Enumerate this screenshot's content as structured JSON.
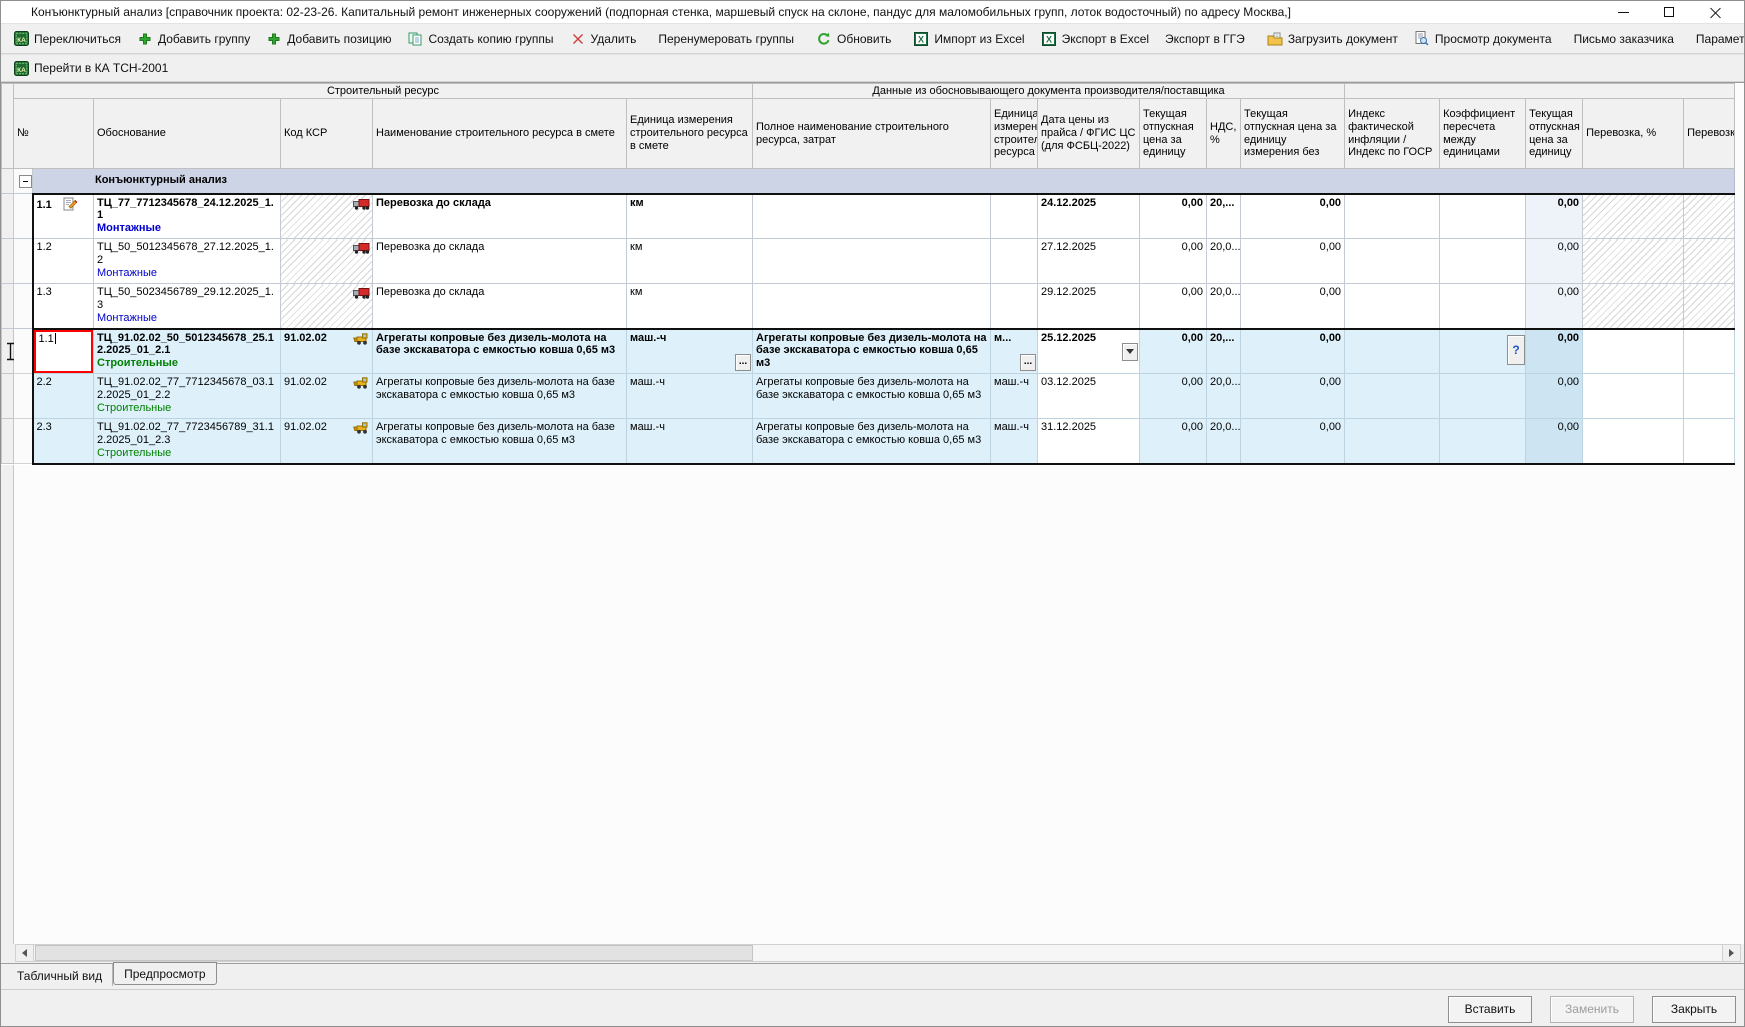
{
  "window": {
    "title": "Конъюнктурный анализ [справочник проекта: 02-23-26. Капитальный ремонт инженерных сооружений (подпорная стенка, маршевый спуск на склоне, пандус для маломобильных групп, лоток водосточный) по адресу Москва,]"
  },
  "toolbar": {
    "items": [
      {
        "label": "Переключиться",
        "icon": "ka-icon"
      },
      {
        "label": "Добавить группу",
        "icon": "plus-icon"
      },
      {
        "label": "Добавить позицию",
        "icon": "plus-icon"
      },
      {
        "label": "Создать копию группы",
        "icon": "copy-icon"
      },
      {
        "label": "Удалить",
        "icon": "delete-icon"
      },
      {
        "sep": true
      },
      {
        "label": "Перенумеровать группы"
      },
      {
        "sep": true
      },
      {
        "label": "Обновить",
        "icon": "refresh-icon"
      },
      {
        "sep": true
      },
      {
        "label": "Импорт из Excel",
        "icon": "excel-icon"
      },
      {
        "label": "Экспорт в Excel",
        "icon": "excel-icon"
      },
      {
        "label": "Экспорт в ГГЭ"
      },
      {
        "sep": true
      },
      {
        "label": "Загрузить документ",
        "icon": "upload-doc-icon"
      },
      {
        "label": "Просмотр документа",
        "icon": "view-doc-icon"
      },
      {
        "sep": true
      },
      {
        "label": "Письмо заказчика"
      },
      {
        "sep": true
      },
      {
        "label": "Параметры"
      }
    ]
  },
  "toolbar2": {
    "items": [
      {
        "label": "Перейти в КА ТСН-2001",
        "icon": "ka-icon"
      }
    ]
  },
  "table": {
    "band_left": "Строительный ресурс",
    "band_center": "Данные из обосновывающего документа производителя/поставщика",
    "group_label": "Конъюнктурный анализ",
    "columns": [
      "№",
      "Обоснование",
      "Код КСР",
      "Наименование строительного ресурса в смете",
      "Единица измерения строительного ресурса в смете",
      "Полное наименование строительного ресурса, затрат",
      "Единица измерения строительного ресурса",
      "Дата цены из прайса / ФГИС ЦС (для ФСБЦ-2022)",
      "Текущая отпускная цена за единицу",
      "НДС, %",
      "Текущая отпускная цена за единицу измерения без",
      "Индекс фактической инфляции / Индекс по  ГОСР",
      "Коэффициент пересчета между единицами",
      "Текущая отпускная цена за единицу",
      "Перевозка, %",
      "Перевозка"
    ],
    "rows": [
      {
        "num": "1.1",
        "editing": false,
        "note_icon": true,
        "basis": "ТЦ_77_7712345678_24.12.2025_1.1",
        "category": "Монтажные",
        "category_class": "cat-blue",
        "ksr_code": "",
        "ksr_hatched": true,
        "vehicle": "red-truck",
        "name": "Перевозка до склада",
        "unit": "км",
        "full_name": "",
        "full_unit": "",
        "price_date": "24.12.2025",
        "price": "0,00",
        "vat": "20,...",
        "price_no_vat": "0,00",
        "inflation": "",
        "coef": "",
        "unit_price": "0,00",
        "bold": true,
        "highlight": false,
        "group_start": true,
        "group_end": false,
        "date_dropdown": false,
        "unit_ellipsis": false,
        "full_unit_ellipsis": false,
        "coef_help": false
      },
      {
        "num": "1.2",
        "editing": false,
        "note_icon": false,
        "basis": "ТЦ_50_5012345678_27.12.2025_1.2",
        "category": "Монтажные",
        "category_class": "cat-blue",
        "ksr_code": "",
        "ksr_hatched": true,
        "vehicle": "red-truck",
        "name": "Перевозка до склада",
        "unit": "км",
        "full_name": "",
        "full_unit": "",
        "price_date": "27.12.2025",
        "price": "0,00",
        "vat": "20,0...",
        "price_no_vat": "0,00",
        "inflation": "",
        "coef": "",
        "unit_price": "0,00",
        "bold": false,
        "highlight": false,
        "group_start": false,
        "group_end": false,
        "date_dropdown": false,
        "unit_ellipsis": false,
        "full_unit_ellipsis": false,
        "coef_help": false
      },
      {
        "num": "1.3",
        "editing": false,
        "note_icon": false,
        "basis": "ТЦ_50_5023456789_29.12.2025_1.3",
        "category": "Монтажные",
        "category_class": "cat-blue",
        "ksr_code": "",
        "ksr_hatched": true,
        "vehicle": "red-truck",
        "name": "Перевозка до склада",
        "unit": "км",
        "full_name": "",
        "full_unit": "",
        "price_date": "29.12.2025",
        "price": "0,00",
        "vat": "20,0...",
        "price_no_vat": "0,00",
        "inflation": "",
        "coef": "",
        "unit_price": "0,00",
        "bold": false,
        "highlight": false,
        "group_start": false,
        "group_end": true,
        "date_dropdown": false,
        "unit_ellipsis": false,
        "full_unit_ellipsis": false,
        "coef_help": false
      },
      {
        "num": "1.1",
        "editing": true,
        "note_icon": false,
        "basis": "ТЦ_91.02.02_50_5012345678_25.12.2025_01_2.1",
        "category": "Строительные",
        "category_class": "cat-green",
        "ksr_code": "91.02.02",
        "ksr_hatched": false,
        "vehicle": "yellow-loader",
        "name": "Агрегаты копровые без дизель-молота на базе экскаватора с емкостью ковша 0,65 м3",
        "unit": "маш.-ч",
        "full_name": "Агрегаты копровые без дизель-молота на базе экскаватора с емкостью ковша 0,65 м3",
        "full_unit": "м...",
        "price_date": "25.12.2025",
        "price": "0,00",
        "vat": "20,...",
        "price_no_vat": "0,00",
        "inflation": "",
        "coef": "",
        "unit_price": "0,00",
        "bold": true,
        "highlight": true,
        "group_start": true,
        "group_end": false,
        "date_dropdown": true,
        "unit_ellipsis": true,
        "full_unit_ellipsis": true,
        "coef_help": true
      },
      {
        "num": "2.2",
        "editing": false,
        "note_icon": false,
        "basis": "ТЦ_91.02.02_77_7712345678_03.12.2025_01_2.2",
        "category": "Строительные",
        "category_class": "cat-green",
        "ksr_code": "91.02.02",
        "ksr_hatched": false,
        "vehicle": "yellow-loader",
        "name": "Агрегаты копровые без дизель-молота на базе экскаватора с емкостью ковша 0,65 м3",
        "unit": "маш.-ч",
        "full_name": "Агрегаты копровые без дизель-молота на базе экскаватора с емкостью ковша 0,65 м3",
        "full_unit": "маш.-ч",
        "price_date": "03.12.2025",
        "price": "0,00",
        "vat": "20,0...",
        "price_no_vat": "0,00",
        "inflation": "",
        "coef": "",
        "unit_price": "0,00",
        "bold": false,
        "highlight": true,
        "group_start": false,
        "group_end": false,
        "date_dropdown": false,
        "unit_ellipsis": false,
        "full_unit_ellipsis": false,
        "coef_help": false
      },
      {
        "num": "2.3",
        "editing": false,
        "note_icon": false,
        "basis": "ТЦ_91.02.02_77_7723456789_31.12.2025_01_2.3",
        "category": "Строительные",
        "category_class": "cat-green",
        "ksr_code": "91.02.02",
        "ksr_hatched": false,
        "vehicle": "yellow-loader",
        "name": "Агрегаты копровые без дизель-молота на базе экскаватора с емкостью ковша 0,65 м3",
        "unit": "маш.-ч",
        "full_name": "Агрегаты копровые без дизель-молота на базе экскаватора с емкостью ковша 0,65 м3",
        "full_unit": "маш.-ч",
        "price_date": "31.12.2025",
        "price": "0,00",
        "vat": "20,0...",
        "price_no_vat": "0,00",
        "inflation": "",
        "coef": "",
        "unit_price": "0,00",
        "bold": false,
        "highlight": true,
        "group_start": false,
        "group_end": true,
        "date_dropdown": false,
        "unit_ellipsis": false,
        "full_unit_ellipsis": false,
        "coef_help": false
      }
    ]
  },
  "tabs": [
    {
      "label": "Табличный вид",
      "active": true
    },
    {
      "label": "Предпросмотр",
      "active": false
    }
  ],
  "footer": {
    "buttons": [
      {
        "label": "Вставить",
        "enabled": true
      },
      {
        "label": "Заменить",
        "enabled": false
      },
      {
        "label": "Закрыть",
        "enabled": true
      }
    ]
  },
  "colors": {
    "category_blue": "#0000cc",
    "category_green": "#008000",
    "edit_border": "#ff0000",
    "row_highlight": "#def1fb",
    "group_row_bg": "#cdd4e5"
  }
}
